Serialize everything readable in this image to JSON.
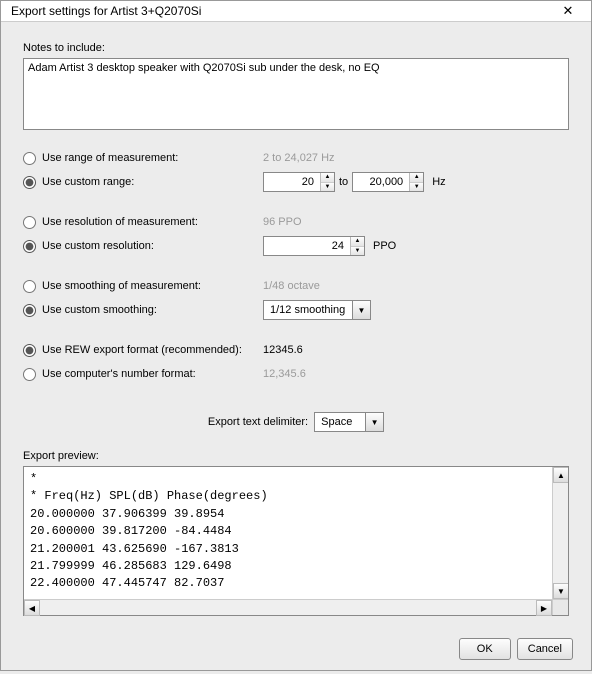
{
  "window": {
    "title": "Export settings for Artist 3+Q2070Si",
    "close_glyph": "✕"
  },
  "notes": {
    "label": "Notes to include:",
    "value": "Adam Artist 3 desktop speaker with Q2070Si sub under the desk, no EQ"
  },
  "range": {
    "measurement_label": "Use range of measurement:",
    "measurement_hint": "2 to 24,027 Hz",
    "custom_label": "Use custom range:",
    "from": "20",
    "to_label": "to",
    "to": "20,000",
    "unit": "Hz",
    "selected": "custom"
  },
  "resolution": {
    "measurement_label": "Use resolution of measurement:",
    "measurement_hint": "96 PPO",
    "custom_label": "Use custom resolution:",
    "value": "24",
    "unit": "PPO",
    "selected": "custom"
  },
  "smoothing": {
    "measurement_label": "Use smoothing of measurement:",
    "measurement_hint": "1/48 octave",
    "custom_label": "Use custom smoothing:",
    "value": "1/12 smoothing",
    "selected": "custom"
  },
  "format": {
    "rew_label": "Use REW export format (recommended):",
    "rew_hint": "12345.6",
    "computer_label": "Use computer's number format:",
    "computer_hint": "12,345.6",
    "selected": "rew"
  },
  "delimiter": {
    "label": "Export text delimiter:",
    "value": "Space"
  },
  "preview": {
    "label": "Export preview:",
    "text": "*\n* Freq(Hz) SPL(dB) Phase(degrees)\n20.000000 37.906399 39.8954\n20.600000 39.817200 -84.4484\n21.200001 43.625690 -167.3813\n21.799999 46.285683 129.6498\n22.400000 47.445747 82.7037"
  },
  "buttons": {
    "ok": "OK",
    "cancel": "Cancel"
  },
  "glyphs": {
    "up": "▲",
    "down": "▼",
    "left": "◀",
    "right": "▶"
  }
}
